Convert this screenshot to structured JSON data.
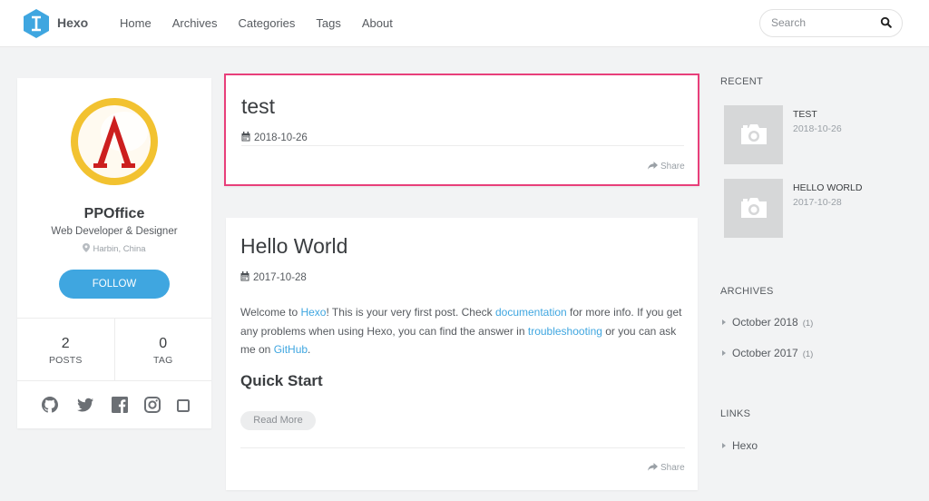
{
  "header": {
    "brand": "Hexo",
    "nav": [
      "Home",
      "Archives",
      "Categories",
      "Tags",
      "About"
    ],
    "search_placeholder": "Search"
  },
  "profile": {
    "name": "PPOffice",
    "title": "Web Developer & Designer",
    "location": "Harbin, China",
    "follow_label": "FOLLOW",
    "posts_count": "2",
    "posts_label": "POSTS",
    "tags_count": "0",
    "tags_label": "TAG",
    "social": [
      "github-icon",
      "twitter-icon",
      "facebook-icon",
      "instagram-icon",
      "square-icon"
    ]
  },
  "posts": [
    {
      "title": "test",
      "date": "2018-10-26",
      "share": "Share"
    },
    {
      "title": "Hello World",
      "date": "2017-10-28",
      "body": {
        "t1": "Welcome to ",
        "l1": "Hexo",
        "t2": "! This is your very first post. Check ",
        "l2": "documentation",
        "t3": " for more info. If you get any problems when using Hexo, you can find the answer in ",
        "l3": "troubleshooting",
        "t4": " or you can ask me on ",
        "l4": "GitHub",
        "t5": "."
      },
      "heading": "Quick Start",
      "read_more": "Read More",
      "share": "Share"
    }
  ],
  "sidebar": {
    "recent_heading": "RECENT",
    "recent": [
      {
        "title": "TEST",
        "date": "2018-10-26"
      },
      {
        "title": "HELLO WORLD",
        "date": "2017-10-28"
      }
    ],
    "archives_heading": "ARCHIVES",
    "archives": [
      {
        "label": "October 2018",
        "count": "(1)"
      },
      {
        "label": "October 2017",
        "count": "(1)"
      }
    ],
    "links_heading": "LINKS",
    "links": [
      {
        "label": "Hexo"
      }
    ]
  },
  "colors": {
    "accent": "#3fa6e0",
    "highlight_border": "#e83f7a",
    "background": "#f2f3f4"
  }
}
